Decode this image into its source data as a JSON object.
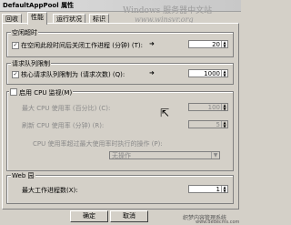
{
  "window": {
    "title": "DefaultAppPool 属性",
    "watermark_top": "Windows 服务器中文站",
    "watermark_url": "www.winsvr.org",
    "watermark_bottom": "织梦内容管理系统",
    "watermark_bottom2": "www.dedecms.com"
  },
  "tabs": [
    {
      "label": "回收"
    },
    {
      "label": "性能"
    },
    {
      "label": "运行状况"
    },
    {
      "label": "标识"
    }
  ],
  "idle_timeout": {
    "group_label": "空闲超时",
    "checkbox_label": "在空闲此段时间后关闭工作进程 (分钟) (T):",
    "value": "20"
  },
  "request_queue": {
    "group_label": "请求队列限制",
    "checkbox_label": "核心请求队列限制为 (请求次数) (Q):",
    "value": "1000"
  },
  "cpu_monitoring": {
    "checkbox_label": "启用 CPU 监视(M)",
    "max_usage_label": "最大 CPU 使用率 (百分比) (C):",
    "max_usage_value": "100",
    "refresh_label": "刷新 CPU 使用率 (分钟) (R):",
    "refresh_value": "5",
    "action_label": "CPU 使用率超过最大使用率时执行的操作 (P):",
    "action_value": "无操作"
  },
  "web_garden": {
    "group_label": "Web 园",
    "max_processes_label": "最大工作进程数(X):",
    "max_processes_value": "1"
  },
  "buttons": {
    "ok": "确定",
    "cancel": "取消"
  }
}
